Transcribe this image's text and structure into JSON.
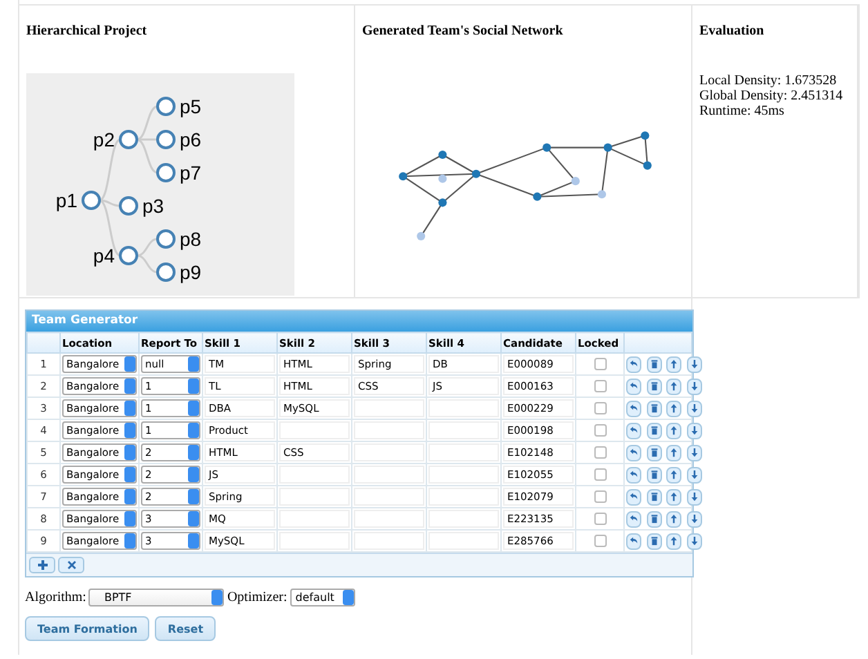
{
  "panels": {
    "hierarchy_title": "Hierarchical Project",
    "network_title": "Generated Team's Social Network",
    "evaluation_title": "Evaluation"
  },
  "tree": {
    "label": "p1",
    "children": [
      {
        "label": "p2",
        "children": [
          {
            "label": "p5"
          },
          {
            "label": "p6"
          },
          {
            "label": "p7"
          }
        ]
      },
      {
        "label": "p3"
      },
      {
        "label": "p4",
        "children": [
          {
            "label": "p8"
          },
          {
            "label": "p9"
          }
        ]
      }
    ]
  },
  "evaluation": [
    "Local Density: 1.673528",
    "Global Density: 2.451314",
    "Runtime: 45ms"
  ],
  "table": {
    "title": "Team Generator",
    "columns": [
      "Location",
      "Report To",
      "Skill 1",
      "Skill 2",
      "Skill 3",
      "Skill 4",
      "Candidate",
      "Locked"
    ],
    "rows": [
      {
        "index": "1",
        "location": "Bangalore",
        "report_to": "null",
        "skills": [
          "TM",
          "HTML",
          "Spring",
          "DB"
        ],
        "candidate": "E000089",
        "locked": false
      },
      {
        "index": "2",
        "location": "Bangalore",
        "report_to": "1",
        "skills": [
          "TL",
          "HTML",
          "CSS",
          "JS"
        ],
        "candidate": "E000163",
        "locked": false
      },
      {
        "index": "3",
        "location": "Bangalore",
        "report_to": "1",
        "skills": [
          "DBA",
          "MySQL"
        ],
        "candidate": "E000229",
        "locked": false
      },
      {
        "index": "4",
        "location": "Bangalore",
        "report_to": "1",
        "skills": [
          "Product"
        ],
        "candidate": "E000198",
        "locked": false
      },
      {
        "index": "5",
        "location": "Bangalore",
        "report_to": "2",
        "skills": [
          "HTML",
          "CSS"
        ],
        "candidate": "E102148",
        "locked": false
      },
      {
        "index": "6",
        "location": "Bangalore",
        "report_to": "2",
        "skills": [
          "JS"
        ],
        "candidate": "E102055",
        "locked": false
      },
      {
        "index": "7",
        "location": "Bangalore",
        "report_to": "2",
        "skills": [
          "Spring"
        ],
        "candidate": "E102079",
        "locked": false
      },
      {
        "index": "8",
        "location": "Bangalore",
        "report_to": "3",
        "skills": [
          "MQ"
        ],
        "candidate": "E223135",
        "locked": false
      },
      {
        "index": "9",
        "location": "Bangalore",
        "report_to": "3",
        "skills": [
          "MySQL"
        ],
        "candidate": "E285766",
        "locked": false
      }
    ]
  },
  "algorithm": {
    "label": "Algorithm:",
    "value": "BPTF"
  },
  "optimizer": {
    "label": "Optimizer:",
    "value": "default"
  },
  "buttons": [
    "Team Formation",
    "Reset"
  ]
}
